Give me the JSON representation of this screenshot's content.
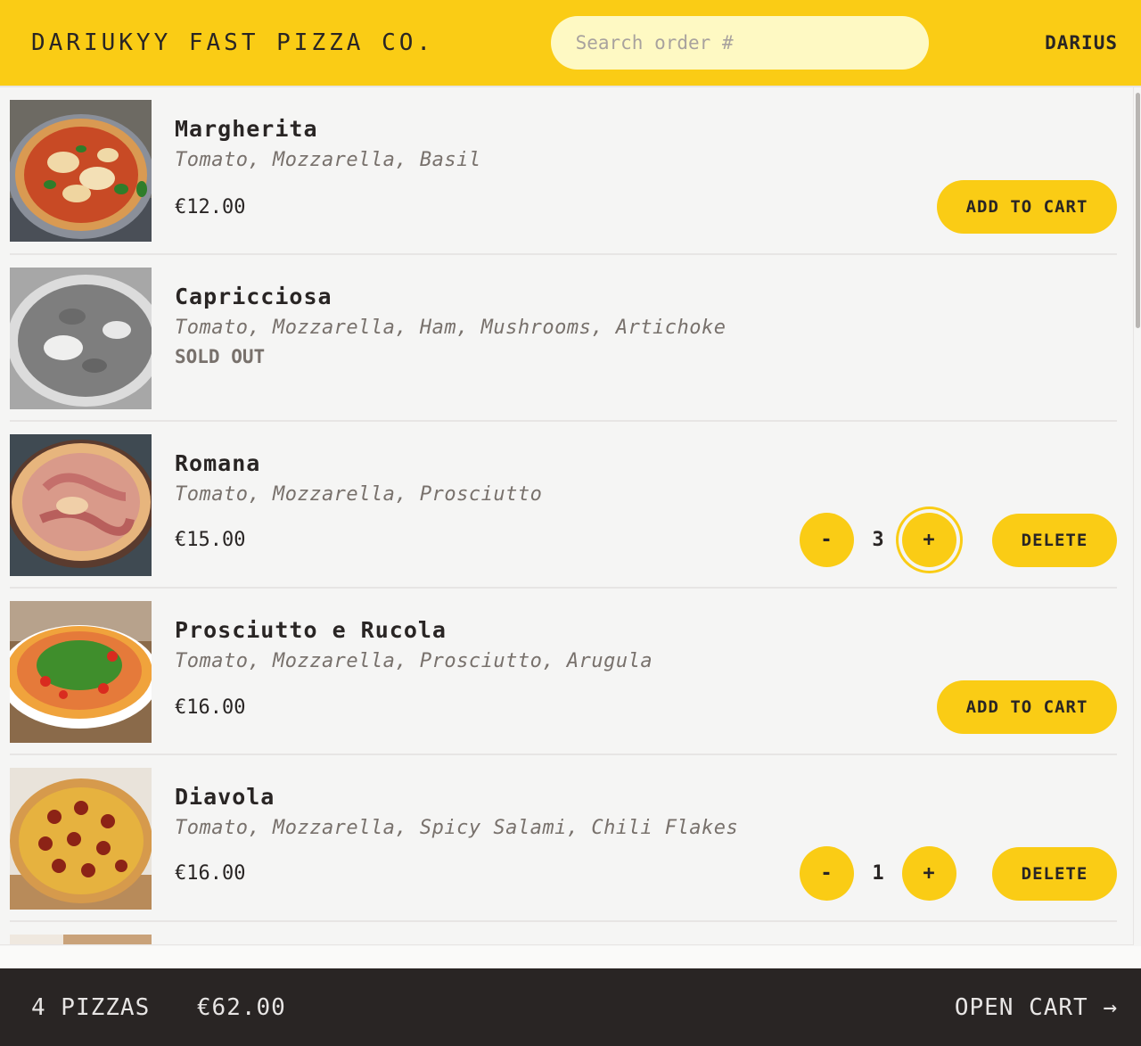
{
  "header": {
    "logo": "Dariukyy Fast Pizza Co.",
    "search_placeholder": "Search order #",
    "username": "DARIUS"
  },
  "menu": [
    {
      "name": "Margherita",
      "ingredients": "Tomato, Mozzarella, Basil",
      "price": "€12.00",
      "sold_out": false,
      "in_cart": false,
      "add_label": "Add to cart",
      "image": "margherita pizza photo"
    },
    {
      "name": "Capricciosa",
      "ingredients": "Tomato, Mozzarella, Ham, Mushrooms, Artichoke",
      "sold_out": true,
      "sold_out_label": "Sold out",
      "image": "capricciosa pizza photo (grayscale)"
    },
    {
      "name": "Romana",
      "ingredients": "Tomato, Mozzarella, Prosciutto",
      "price": "€15.00",
      "in_cart": true,
      "quantity": "3",
      "decrease_label": "-",
      "increase_label": "+",
      "delete_label": "Delete",
      "image": "romana pizza photo"
    },
    {
      "name": "Prosciutto e Rucola",
      "ingredients": "Tomato, Mozzarella, Prosciutto, Arugula",
      "price": "€16.00",
      "in_cart": false,
      "add_label": "Add to cart",
      "image": "prosciutto e rucola pizza photo"
    },
    {
      "name": "Diavola",
      "ingredients": "Tomato, Mozzarella, Spicy Salami, Chili Flakes",
      "price": "€16.00",
      "in_cart": true,
      "quantity": "1",
      "decrease_label": "-",
      "increase_label": "+",
      "delete_label": "Delete",
      "image": "diavola pizza photo"
    }
  ],
  "cart": {
    "count": "4 pizzas",
    "total": "€62.00",
    "open_label": "Open cart →"
  },
  "colors": {
    "accent": "#facc15",
    "dark": "#292524",
    "background": "#f5f5f4"
  }
}
